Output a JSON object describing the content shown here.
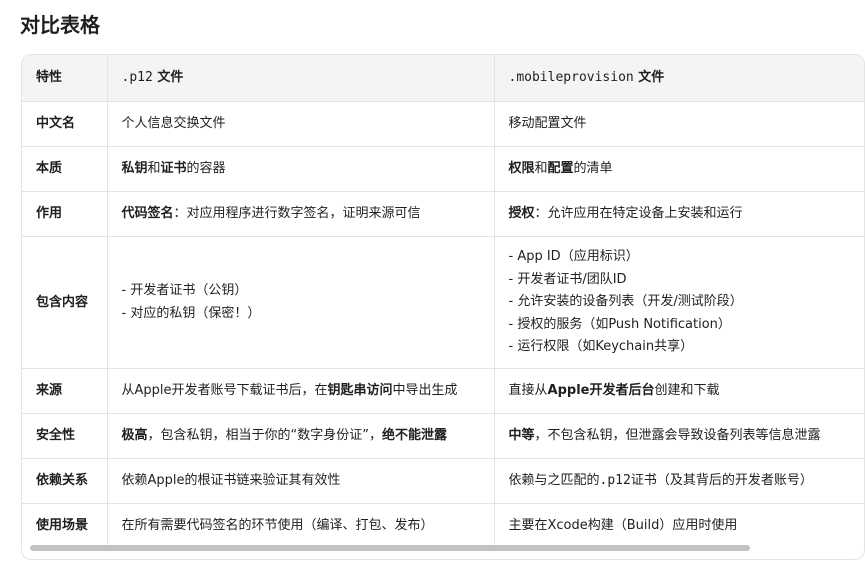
{
  "page": {
    "title": "对比表格"
  },
  "table": {
    "headers": {
      "feature": "特性",
      "p12_code": ".p12",
      "p12_suffix": "文件",
      "mp_code": ".mobileprovision",
      "mp_suffix": "文件"
    },
    "rows": {
      "chinese_name": {
        "label": "中文名",
        "p12": "个人信息交换文件",
        "mp": "移动配置文件"
      },
      "essence": {
        "label": "本质",
        "p12_b1": "私钥",
        "p12_t1": "和",
        "p12_b2": "证书",
        "p12_t2": "的容器",
        "mp_b1": "权限",
        "mp_t1": "和",
        "mp_b2": "配置",
        "mp_t2": "的清单"
      },
      "purpose": {
        "label": "作用",
        "p12_b": "代码签名",
        "p12_t": "：对应用程序进行数字签名，证明来源可信",
        "mp_b": "授权",
        "mp_t": "：允许应用在特定设备上安装和运行"
      },
      "contents": {
        "label": "包含内容",
        "p12_lines": [
          "- 开发者证书（公钥）",
          "- 对应的私钥（保密！）"
        ],
        "mp_lines": [
          "- App ID（应用标识）",
          "- 开发者证书/团队ID",
          "- 允许安装的设备列表（开发/测试阶段）",
          "- 授权的服务（如Push Notification）",
          "- 运行权限（如Keychain共享）"
        ]
      },
      "source": {
        "label": "来源",
        "p12_t1": "从Apple开发者账号下载证书后，在",
        "p12_b": "钥匙串访问",
        "p12_t2": "中导出生成",
        "mp_t1": "直接从",
        "mp_b": "Apple开发者后台",
        "mp_t2": "创建和下载"
      },
      "security": {
        "label": "安全性",
        "p12_b1": "极高",
        "p12_t1": "，包含私钥，相当于你的“数字身份证”，",
        "p12_b2": "绝不能泄露",
        "mp_b": "中等",
        "mp_t": "，不包含私钥，但泄露会导致设备列表等信息泄露"
      },
      "dependency": {
        "label": "依赖关系",
        "p12": "依赖Apple的根证书链来验证其有效性",
        "mp_t1": "依赖与之匹配的",
        "mp_code": ".p12",
        "mp_t2": "证书（及其背后的开发者账号）"
      },
      "usage": {
        "label": "使用场景",
        "p12": "在所有需要代码签名的环节使用（编译、打包、发布）",
        "mp": "主要在Xcode构建（Build）应用时使用"
      }
    }
  }
}
